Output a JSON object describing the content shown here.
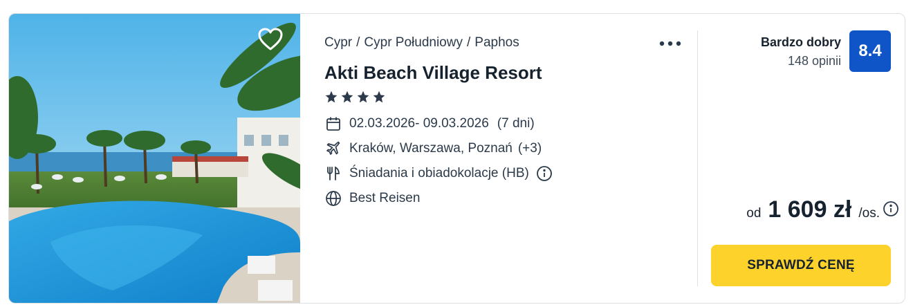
{
  "hotel": {
    "breadcrumb": [
      "Cypr",
      "Cypr Południowy",
      "Paphos"
    ],
    "breadcrumb_separator": "/",
    "name": "Akti Beach Village Resort",
    "stars": 4,
    "dates": "02.03.2026- 09.03.2026",
    "duration": "(7 dni)",
    "departure": "Kraków, Warszawa, Poznań",
    "departure_extra": "(+3)",
    "board": "Śniadania i obiadokolacje (HB)",
    "operator": "Best Reisen"
  },
  "rating": {
    "label": "Bardzo dobry",
    "count": "148 opinii",
    "score": "8.4"
  },
  "price": {
    "prefix": "od",
    "amount": "1 609 zł",
    "suffix": "/os."
  },
  "cta": {
    "label": "SPRAWDŹ CENĘ"
  },
  "icons": {
    "favorite": "heart-icon",
    "more": "more-dots-icon",
    "star": "star-icon",
    "dates": "calendar-icon",
    "departure": "plane-icon",
    "board": "utensils-icon",
    "operator": "globe-icon",
    "info": "info-icon"
  },
  "colors": {
    "rating_badge": "#1055c7",
    "cta_background": "#fdd22a",
    "text_dark": "#17222f"
  }
}
